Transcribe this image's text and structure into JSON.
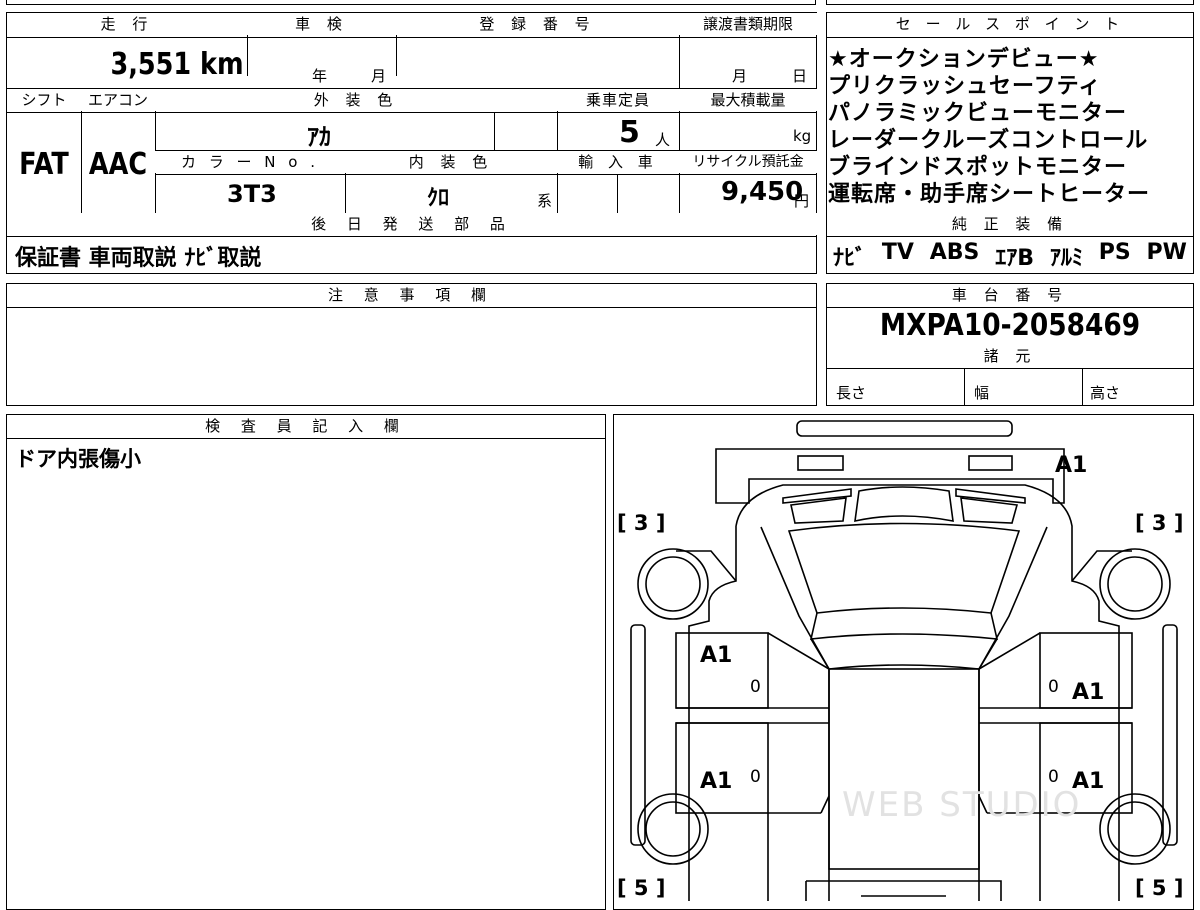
{
  "main": {
    "headers": {
      "mileage": "走 行",
      "inspection": "車 検",
      "registration": "登 録 番 号",
      "transfer_deadline": "譲渡書類期限",
      "shift": "シフト",
      "aircon": "エアコン",
      "exterior_color": "外 装 色",
      "capacity": "乗車定員",
      "max_load": "最大積載量",
      "color_no": "カ ラ ー N o .",
      "interior_color": "内 装 色",
      "import": "輸 入 車",
      "recycle": "リサイクル預託金",
      "later_parts": "後 日 発 送 部 品"
    },
    "mileage_value": "3,551 km",
    "inspection_year": "年",
    "inspection_month": "月",
    "transfer_month": "月",
    "transfer_day": "日",
    "shift_value": "FAT",
    "aircon_value": "AAC",
    "exterior_color_value": "ｱｶ",
    "capacity_value": "5",
    "capacity_unit": "人",
    "max_load_unit": "kg",
    "color_no_value": "3T3",
    "interior_color_value": "ｸﾛ",
    "interior_color_suffix": "系",
    "recycle_value": "9,450",
    "recycle_unit": "円",
    "later_parts_value": "保証書 車両取説 ﾅﾋﾞ取説"
  },
  "sales": {
    "header": "セ ー ル ス ポ イ ン ト",
    "points": [
      "★オークションデビュー★",
      "プリクラッシュセーフティ",
      "パノラミックビューモニター",
      "レーダークルーズコントロール",
      "ブラインドスポットモニター",
      "運転席・助手席シートヒーター"
    ],
    "equipment_header": "純 正 装 備",
    "equipment": [
      "ﾅﾋﾞ",
      "TV",
      "ABS",
      "ｴｱB",
      "ｱﾙﾐ",
      "PS",
      "PW"
    ]
  },
  "notes": {
    "header": "注 意 事 項 欄",
    "value": ""
  },
  "chassis": {
    "header": "車 台 番 号",
    "value": "MXPA10-2058469",
    "specs_header": "諸 元",
    "length": "長さ",
    "width": "幅",
    "height": "高さ"
  },
  "inspector": {
    "header": "検 査 員 記 入 欄",
    "value": "ドア内張傷小"
  },
  "diagram": {
    "marks": {
      "rear_bumper": "A1",
      "left_front_door": "A1",
      "left_rear_door": "A1",
      "right_front_door": "A1",
      "right_rear_door": "A1",
      "front_left_tire": "[ 3 ]",
      "front_right_tire": "[ 3 ]",
      "rear_left_tire": "[ 5 ]",
      "rear_right_tire": "[ 5 ]",
      "zero_1": "0",
      "zero_2": "0",
      "zero_3": "0",
      "zero_4": "0"
    },
    "watermark": "WEB STUDIO"
  }
}
